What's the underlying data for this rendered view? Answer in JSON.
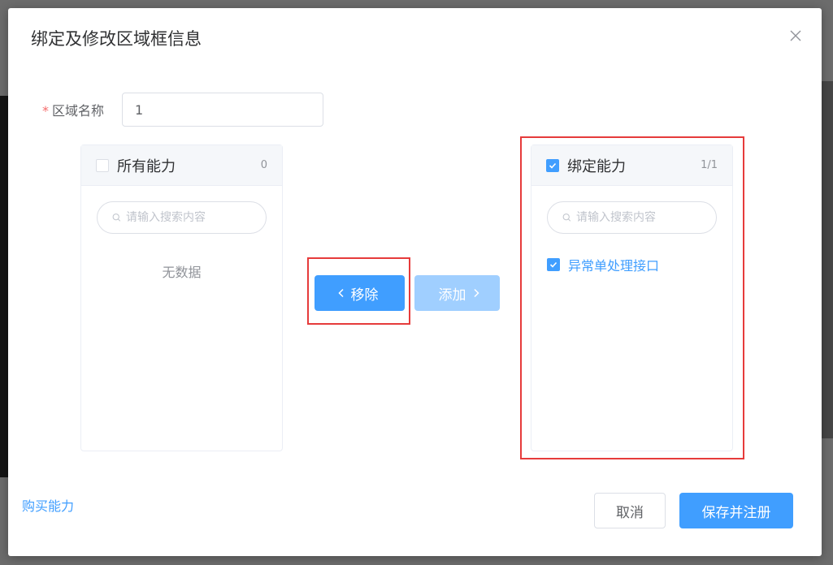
{
  "dialog": {
    "title": "绑定及修改区域框信息"
  },
  "form": {
    "required_mark": "*",
    "name_label": "区域名称",
    "name_value": "1"
  },
  "left_panel": {
    "title": "所有能力",
    "count": "0",
    "checked": false,
    "search_placeholder": "请输入搜索内容",
    "empty_text": "无数据"
  },
  "right_panel": {
    "title": "绑定能力",
    "count": "1/1",
    "checked": true,
    "search_placeholder": "请输入搜索内容",
    "items": [
      {
        "label": "异常单处理接口",
        "checked": true
      }
    ]
  },
  "transfer": {
    "remove_label": "移除",
    "add_label": "添加"
  },
  "footer": {
    "buy_link": "购买能力",
    "cancel_label": "取消",
    "save_label": "保存并注册"
  },
  "colors": {
    "primary": "#409eff",
    "primary_disabled": "#a0cfff",
    "highlight": "#e63b3b"
  },
  "icons": {
    "close": "close-icon",
    "search": "search-icon",
    "chevron_left": "chevron-left-icon",
    "chevron_right": "chevron-right-icon",
    "check": "check-icon"
  }
}
